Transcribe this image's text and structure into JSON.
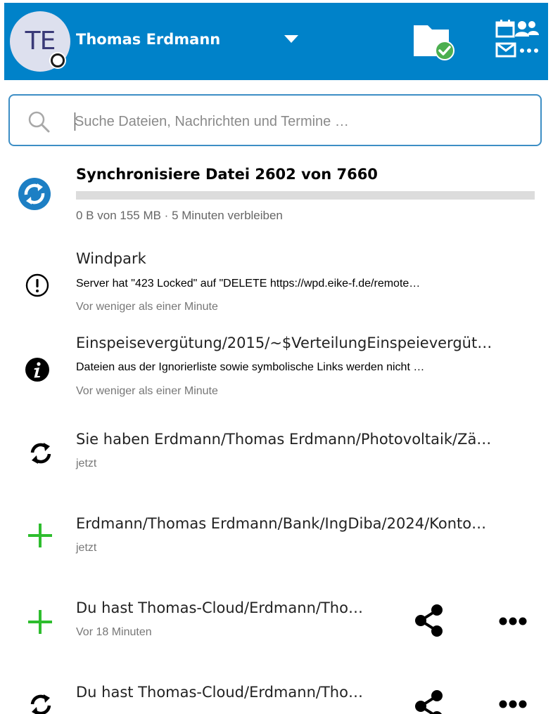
{
  "header": {
    "avatar_initials": "TE",
    "username": "Thomas Erdmann",
    "colors": {
      "bar": "#0082c9",
      "status_ok": "#4caf50"
    }
  },
  "search": {
    "placeholder": "Suche Dateien, Nachrichten und Termine …"
  },
  "sync": {
    "title": "Synchronisiere Datei 2602 von 7660",
    "subtitle": "0 B von 155 MB · 5 Minuten verbleiben",
    "progress": 0.0
  },
  "activities": [
    {
      "icon": "warning-icon",
      "title": "Windpark",
      "message": "Server hat \"423 Locked\" auf \"DELETE https://wpd.eike-f.de/remote…",
      "time": "Vor weniger als einer Minute"
    },
    {
      "icon": "info-icon",
      "title": "Einspeisevergütung/2015/~$VerteilungEinspeievergüt…",
      "message": "Dateien aus der Ignorierliste sowie symbolische Links werden nicht …",
      "time": "Vor weniger als einer Minute"
    },
    {
      "icon": "sync-icon",
      "title": "Sie haben Erdmann/Thomas Erdmann/Photovoltaik/Zä…",
      "time": "jetzt"
    },
    {
      "icon": "plus-icon",
      "title": "Erdmann/Thomas Erdmann/Bank/IngDiba/2024/Konto…",
      "time": "jetzt"
    },
    {
      "icon": "plus-icon",
      "title": "Du hast Thomas-Cloud/Erdmann/Tho…",
      "time": "Vor 18 Minuten"
    },
    {
      "icon": "sync-icon",
      "title": "Du hast Thomas-Cloud/Erdmann/Tho…"
    }
  ]
}
